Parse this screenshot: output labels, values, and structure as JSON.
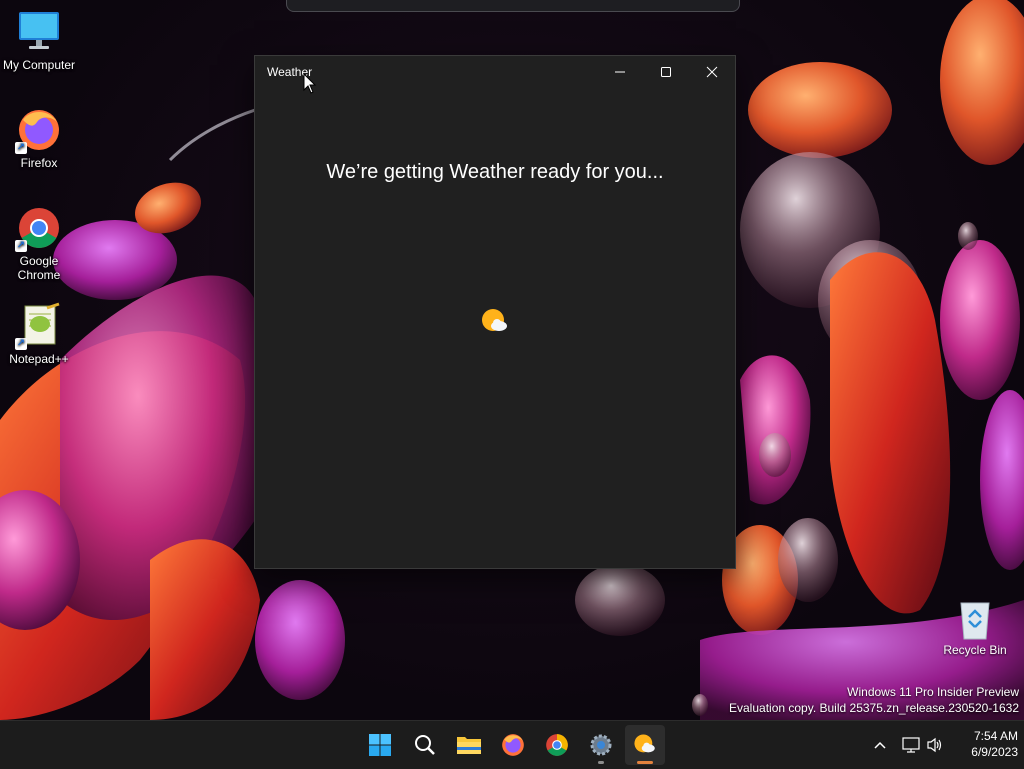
{
  "desktop": {
    "icons": [
      {
        "label": "My Computer",
        "icon": "monitor-icon"
      },
      {
        "label": "Firefox",
        "icon": "firefox-icon"
      },
      {
        "label": "Google Chrome",
        "icon": "chrome-icon"
      },
      {
        "label": "Notepad++",
        "icon": "notepad-plus-plus-icon"
      }
    ],
    "recycle_bin": {
      "label": "Recycle Bin",
      "icon": "recycle-bin-icon"
    },
    "watermark": {
      "line1": "Windows 11 Pro Insider Preview",
      "line2": "Evaluation copy. Build 25375.zn_release.230520-1632"
    }
  },
  "window": {
    "title": "Weather",
    "loading_message": "We’re getting Weather ready for you...",
    "loading_icon": "sun-cloud-icon",
    "controls": {
      "minimize": "minimize-icon",
      "maximize": "maximize-icon",
      "close": "close-icon"
    }
  },
  "taskbar": {
    "apps": [
      {
        "name": "Start",
        "icon": "windows-start-icon"
      },
      {
        "name": "Search",
        "icon": "search-icon"
      },
      {
        "name": "File Explorer",
        "icon": "folder-icon"
      },
      {
        "name": "Firefox",
        "icon": "firefox-icon"
      },
      {
        "name": "Google Chrome",
        "icon": "chrome-icon"
      },
      {
        "name": "Settings",
        "icon": "gear-icon"
      },
      {
        "name": "Weather",
        "icon": "sun-cloud-icon",
        "active": true
      }
    ],
    "tray": {
      "chevron": "chevron-up-icon",
      "network": "network-icon",
      "volume": "speaker-icon"
    },
    "clock": {
      "time": "7:54 AM",
      "date": "6/9/2023"
    }
  },
  "colors": {
    "window_bg": "#202020",
    "taskbar_bg": "#1c1c1c",
    "accent_active": "#e3823e",
    "windows_blue": "#4cc2ff"
  }
}
